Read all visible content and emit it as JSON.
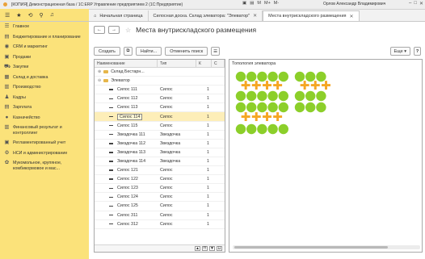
{
  "titlebar": {
    "title": "[КОПИЯ] Демонстрационная база / 1С:ERP Управление предприятием 2 (1С:Предприятие)",
    "user": "Орлов Александр Владимирович",
    "tools": [
      "M",
      "M+",
      "M-"
    ]
  },
  "tabs": [
    {
      "label": "Начальная страница"
    },
    {
      "label": "Силосная доска. Склад элеватора: \"Элеватор\""
    },
    {
      "label": "Места внутрискладского размещения"
    }
  ],
  "sidebar": {
    "items": [
      {
        "icon": "menu-icon",
        "glyph": "☰",
        "label": "Главное"
      },
      {
        "icon": "budget-icon",
        "glyph": "▤",
        "label": "Бюджетирование и планирование"
      },
      {
        "icon": "crm-icon",
        "glyph": "◉",
        "label": "CRM и маркетинг"
      },
      {
        "icon": "sales-icon",
        "glyph": "▣",
        "label": "Продажи"
      },
      {
        "icon": "cart-icon",
        "glyph": "⛟",
        "label": "Закупки"
      },
      {
        "icon": "warehouse-icon",
        "glyph": "▦",
        "label": "Склад и доставка"
      },
      {
        "icon": "production-icon",
        "glyph": "▥",
        "label": "Производство"
      },
      {
        "icon": "staff-icon",
        "glyph": "♟",
        "label": "Кадры"
      },
      {
        "icon": "salary-icon",
        "glyph": "▤",
        "label": "Зарплата"
      },
      {
        "icon": "treasury-icon",
        "glyph": "●",
        "label": "Казначейство"
      },
      {
        "icon": "finance-icon",
        "glyph": "▥",
        "label": "Финансовый результат и контроллинг"
      },
      {
        "icon": "regulated-icon",
        "glyph": "▣",
        "label": "Регламентированный учет"
      },
      {
        "icon": "settings-icon",
        "glyph": "⚙",
        "label": "НСИ и администрирование"
      },
      {
        "icon": "grain-icon",
        "glyph": "✿",
        "label": "Мукомольное, крупяное, комбикормовое и мас..."
      }
    ]
  },
  "page": {
    "title": "Места внутрискладского размещения"
  },
  "toolbar": {
    "create": "Создать",
    "find": "Найти...",
    "cancel_search": "Отменить поиск",
    "more": "Еще ▾",
    "help": "?"
  },
  "tree": {
    "columns": [
      "Наименование",
      "Тип",
      "К",
      "С"
    ],
    "rows": [
      {
        "name": "Склад Бестарн...",
        "type": "",
        "k": "",
        "level": 1,
        "folder": true,
        "pm": "⊕"
      },
      {
        "name": "Элеватор",
        "type": "",
        "k": "",
        "level": 1,
        "folder": true,
        "pm": "⊖"
      },
      {
        "name": "Силос 111",
        "type": "Силос",
        "k": "1",
        "level": 2
      },
      {
        "name": "Силос 112",
        "type": "Силос",
        "k": "1",
        "level": 2
      },
      {
        "name": "Силос 113",
        "type": "Силос",
        "k": "1",
        "level": 2
      },
      {
        "name": "Силос 114",
        "type": "Силос",
        "k": "1",
        "level": 2,
        "selected": true
      },
      {
        "name": "Силос 115",
        "type": "Силос",
        "k": "1",
        "level": 2
      },
      {
        "name": "Звездочка 111",
        "type": "Звездочка",
        "k": "1",
        "level": 2
      },
      {
        "name": "Звездочка 112",
        "type": "Звездочка",
        "k": "1",
        "level": 2
      },
      {
        "name": "Звездочка 113",
        "type": "Звездочка",
        "k": "1",
        "level": 2
      },
      {
        "name": "Звездочка 114",
        "type": "Звездочка",
        "k": "1",
        "level": 2
      },
      {
        "name": "Силос 121",
        "type": "Силос",
        "k": "1",
        "level": 2
      },
      {
        "name": "Силос 122",
        "type": "Силос",
        "k": "1",
        "level": 2
      },
      {
        "name": "Силос 123",
        "type": "Силос",
        "k": "1",
        "level": 2
      },
      {
        "name": "Силос 124",
        "type": "Силос",
        "k": "1",
        "level": 2
      },
      {
        "name": "Силос 125",
        "type": "Силос",
        "k": "1",
        "level": 2
      },
      {
        "name": "Силос 311",
        "type": "Силос",
        "k": "1",
        "level": 2
      },
      {
        "name": "Силос 312",
        "type": "Силос",
        "k": "1",
        "level": 2
      }
    ]
  },
  "topology": {
    "title": "Топология элеватора",
    "colors": {
      "silo": "#8ccf2a",
      "star": "#f5a623"
    }
  },
  "colors": {
    "sidebar": "#fbe27a",
    "selection": "#fdeeb8"
  }
}
